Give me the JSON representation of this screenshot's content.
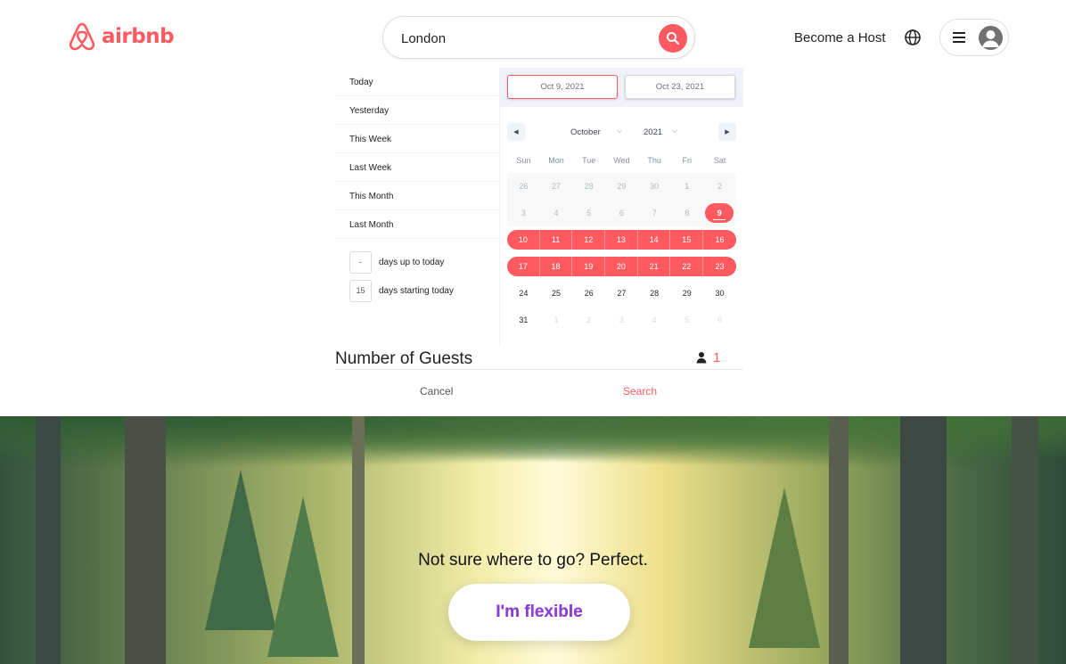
{
  "header": {
    "logo_text": "airbnb",
    "search_value": "London",
    "become_host": "Become a Host",
    "brand_color": "#ff5a5f"
  },
  "date_picker": {
    "presets": [
      "Today",
      "Yesterday",
      "This Week",
      "Last Week",
      "This Month",
      "Last Month"
    ],
    "range_inputs": [
      {
        "value": "-",
        "label": "days up to today"
      },
      {
        "value": "15",
        "label": "days starting today"
      }
    ],
    "start_date": "Oct 9, 2021",
    "end_date": "Oct 23, 2021",
    "month": "October",
    "year": "2021",
    "weekdays": [
      "Sun",
      "Mon",
      "Tue",
      "Wed",
      "Thu",
      "Fri",
      "Sat"
    ],
    "weeks": [
      [
        {
          "d": "26",
          "s": "disabled"
        },
        {
          "d": "27",
          "s": "disabled"
        },
        {
          "d": "28",
          "s": "disabled"
        },
        {
          "d": "29",
          "s": "disabled"
        },
        {
          "d": "30",
          "s": "disabled"
        },
        {
          "d": "1",
          "s": "disabled"
        },
        {
          "d": "2",
          "s": "disabled"
        }
      ],
      [
        {
          "d": "3",
          "s": "disabled"
        },
        {
          "d": "4",
          "s": "disabled"
        },
        {
          "d": "5",
          "s": "disabled"
        },
        {
          "d": "6",
          "s": "disabled"
        },
        {
          "d": "7",
          "s": "disabled"
        },
        {
          "d": "8",
          "s": "disabled"
        },
        {
          "d": "9",
          "s": "selected-start"
        }
      ],
      [
        {
          "d": "10",
          "s": "range-start"
        },
        {
          "d": "11",
          "s": "inrange"
        },
        {
          "d": "12",
          "s": "inrange"
        },
        {
          "d": "13",
          "s": "inrange"
        },
        {
          "d": "14",
          "s": "inrange"
        },
        {
          "d": "15",
          "s": "inrange"
        },
        {
          "d": "16",
          "s": "range-end"
        }
      ],
      [
        {
          "d": "17",
          "s": "range-start"
        },
        {
          "d": "18",
          "s": "inrange"
        },
        {
          "d": "19",
          "s": "inrange"
        },
        {
          "d": "20",
          "s": "inrange"
        },
        {
          "d": "21",
          "s": "inrange"
        },
        {
          "d": "22",
          "s": "inrange"
        },
        {
          "d": "23",
          "s": "range-end"
        }
      ],
      [
        {
          "d": "24",
          "s": ""
        },
        {
          "d": "25",
          "s": ""
        },
        {
          "d": "26",
          "s": ""
        },
        {
          "d": "27",
          "s": ""
        },
        {
          "d": "28",
          "s": ""
        },
        {
          "d": "29",
          "s": ""
        },
        {
          "d": "30",
          "s": ""
        }
      ],
      [
        {
          "d": "31",
          "s": ""
        },
        {
          "d": "1",
          "s": "passive"
        },
        {
          "d": "2",
          "s": "passive"
        },
        {
          "d": "3",
          "s": "passive"
        },
        {
          "d": "4",
          "s": "passive"
        },
        {
          "d": "5",
          "s": "passive"
        },
        {
          "d": "6",
          "s": "passive"
        }
      ]
    ]
  },
  "guests": {
    "title": "Number of Guests",
    "count": "1"
  },
  "actions": {
    "cancel": "Cancel",
    "search": "Search"
  },
  "hero": {
    "title": "Not sure where to go? Perfect.",
    "button": "I'm flexible"
  }
}
